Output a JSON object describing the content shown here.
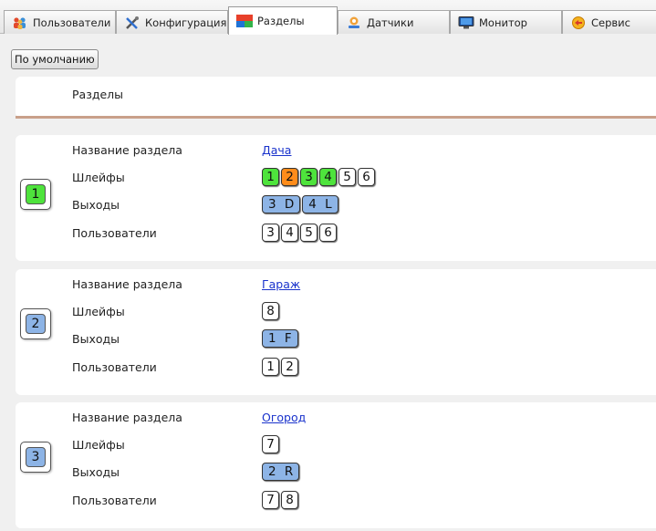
{
  "tabs": [
    {
      "label": "Пользователи",
      "icon": "users-icon",
      "active": false
    },
    {
      "label": "Конфигурация",
      "icon": "tools-icon",
      "active": false
    },
    {
      "label": "Разделы",
      "icon": "sections-icon",
      "active": true
    },
    {
      "label": "Датчики",
      "icon": "sensor-icon",
      "active": false
    },
    {
      "label": "Монитор",
      "icon": "monitor-icon",
      "active": false
    },
    {
      "label": "Сервис",
      "icon": "service-icon",
      "active": false
    }
  ],
  "toolbar": {
    "defaults_label": "По умолчанию"
  },
  "header": {
    "title": "Разделы"
  },
  "labels": {
    "name": "Название раздела",
    "loops": "Шлейфы",
    "outputs": "Выходы",
    "users": "Пользователи"
  },
  "colors": {
    "green": "#4ee33c",
    "orange": "#ff8c1a",
    "blue": "#8db4e6",
    "link": "#1a33cc"
  },
  "sections": [
    {
      "number": "1",
      "number_color": "green",
      "name": "Дача",
      "loops": [
        {
          "label": "1",
          "color": "green"
        },
        {
          "label": "2",
          "color": "orange"
        },
        {
          "label": "3",
          "color": "green"
        },
        {
          "label": "4",
          "color": "green"
        },
        {
          "label": "5",
          "color": "white"
        },
        {
          "label": "6",
          "color": "white"
        }
      ],
      "outputs": [
        {
          "label": "3 D",
          "color": "blue"
        },
        {
          "label": "4 L",
          "color": "blue"
        }
      ],
      "users": [
        {
          "label": "3"
        },
        {
          "label": "4"
        },
        {
          "label": "5"
        },
        {
          "label": "6"
        }
      ]
    },
    {
      "number": "2",
      "number_color": "blue",
      "name": "Гараж",
      "loops": [
        {
          "label": "8",
          "color": "white"
        }
      ],
      "outputs": [
        {
          "label": "1 F",
          "color": "blue"
        }
      ],
      "users": [
        {
          "label": "1"
        },
        {
          "label": "2"
        }
      ]
    },
    {
      "number": "3",
      "number_color": "blue",
      "name": "Огород",
      "loops": [
        {
          "label": "7",
          "color": "white"
        }
      ],
      "outputs": [
        {
          "label": "2 R",
          "color": "blue"
        }
      ],
      "users": [
        {
          "label": "7"
        },
        {
          "label": "8"
        }
      ]
    }
  ]
}
